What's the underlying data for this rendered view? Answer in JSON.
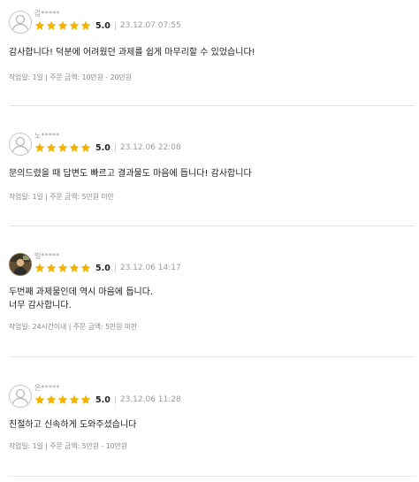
{
  "reviews": [
    {
      "username": "감*****",
      "score": "5.0",
      "date": "23.12.07 07:55",
      "content": "감사합니다! 덕분에 어려웠던 과제를 쉽게 마무리할 수 있었습니다!",
      "meta": "작업일: 1일 | 주문 금액: 10만원 - 20만원",
      "avatar": "default"
    },
    {
      "username": "노*****",
      "score": "5.0",
      "date": "23.12.06 22:08",
      "content": "문의드렸을 때 답변도 빠르고 결과물도 마음에 듭니다! 감사합니다",
      "meta": "작업일: 1일 | 주문 금액: 5만원 미만",
      "avatar": "default"
    },
    {
      "username": "밍*****",
      "score": "5.0",
      "date": "23.12.06 14:17",
      "content_lines": [
        "두번째 과제물인데 역시 마음에 듭니다.",
        "너무 감사합니다."
      ],
      "meta": "작업일: 24시간이내 | 주문 금액: 5만원 미만",
      "avatar": "photo"
    },
    {
      "username": "은*****",
      "score": "5.0",
      "date": "23.12.06 11:28",
      "content": "친절하고 신속하게 도와주셨습니다",
      "meta": "작업일: 1일 | 주문 금액: 5만원 - 10만원",
      "avatar": "default"
    }
  ],
  "colors": {
    "star": "#f5b301",
    "divider": "#e6e6e6",
    "muted": "#9a9a9a"
  }
}
